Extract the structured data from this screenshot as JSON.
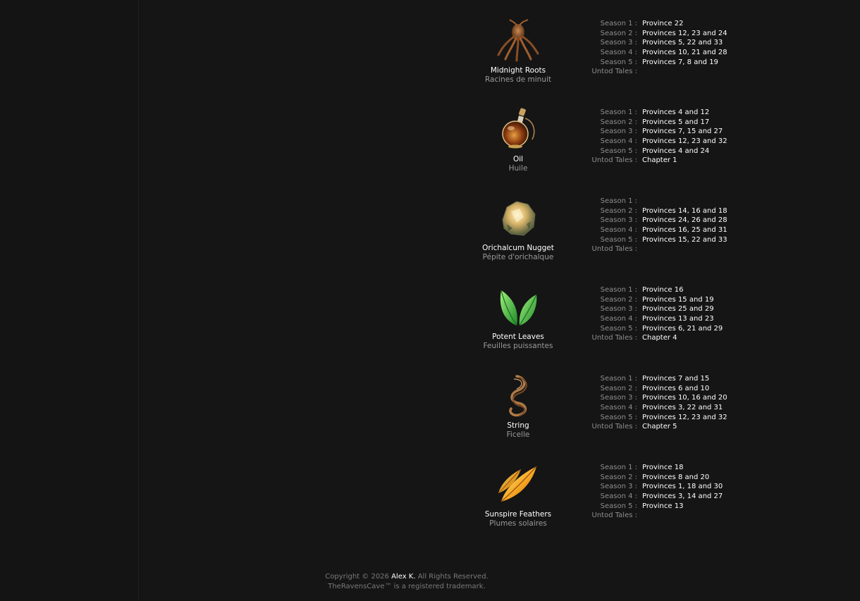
{
  "items": [
    {
      "name_en": "Midnight Roots",
      "name_fr": "Racines de minuit",
      "icon": "midnight-roots-icon",
      "locations": [
        {
          "label": "Season 1 :",
          "value": "Province 22"
        },
        {
          "label": "Season 2 :",
          "value": "Provinces 12, 23 and 24"
        },
        {
          "label": "Season 3 :",
          "value": "Provinces 5, 22 and 33"
        },
        {
          "label": "Season 4 :",
          "value": "Provinces 10, 21 and 28"
        },
        {
          "label": "Season 5 :",
          "value": "Provinces 7, 8 and 19"
        },
        {
          "label": "Untod Tales :",
          "value": ""
        }
      ]
    },
    {
      "name_en": "Oil",
      "name_fr": "Huile",
      "icon": "oil-flask-icon",
      "locations": [
        {
          "label": "Season 1 :",
          "value": "Provinces 4 and 12"
        },
        {
          "label": "Season 2 :",
          "value": "Provinces 5 and 17"
        },
        {
          "label": "Season 3 :",
          "value": "Provinces 7, 15 and 27"
        },
        {
          "label": "Season 4 :",
          "value": "Provinces 12, 23 and 32"
        },
        {
          "label": "Season 5 :",
          "value": "Provinces 4 and 24"
        },
        {
          "label": "Untod Tales :",
          "value": "Chapter 1"
        }
      ]
    },
    {
      "name_en": "Orichalcum Nugget",
      "name_fr": "Pépite d'orichalque",
      "icon": "orichalcum-nugget-icon",
      "locations": [
        {
          "label": "Season 1 :",
          "value": ""
        },
        {
          "label": "Season 2 :",
          "value": "Provinces 14, 16 and 18"
        },
        {
          "label": "Season 3 :",
          "value": "Provinces 24, 26 and 28"
        },
        {
          "label": "Season 4 :",
          "value": "Provinces 16, 25 and 31"
        },
        {
          "label": "Season 5 :",
          "value": "Provinces 15, 22 and 33"
        },
        {
          "label": "Untod Tales :",
          "value": ""
        }
      ]
    },
    {
      "name_en": "Potent Leaves",
      "name_fr": "Feuilles puissantes",
      "icon": "potent-leaves-icon",
      "locations": [
        {
          "label": "Season 1 :",
          "value": "Province 16"
        },
        {
          "label": "Season 2 :",
          "value": "Provinces 15 and 19"
        },
        {
          "label": "Season 3 :",
          "value": "Provinces 25 and 29"
        },
        {
          "label": "Season 4 :",
          "value": "Provinces 13 and 23"
        },
        {
          "label": "Season 5 :",
          "value": "Provinces 6, 21 and 29"
        },
        {
          "label": "Untod Tales :",
          "value": "Chapter 4"
        }
      ]
    },
    {
      "name_en": "String",
      "name_fr": "Ficelle",
      "icon": "string-coil-icon",
      "locations": [
        {
          "label": "Season 1 :",
          "value": "Provinces 7 and 15"
        },
        {
          "label": "Season 2 :",
          "value": "Provinces 6 and 10"
        },
        {
          "label": "Season 3 :",
          "value": "Provinces 10, 16 and 20"
        },
        {
          "label": "Season 4 :",
          "value": "Provinces 3, 22 and 31"
        },
        {
          "label": "Season 5 :",
          "value": "Provinces 12, 23 and 32"
        },
        {
          "label": "Untod Tales :",
          "value": "Chapter 5"
        }
      ]
    },
    {
      "name_en": "Sunspire Feathers",
      "name_fr": "Plumes solaires",
      "icon": "sunspire-feathers-icon",
      "locations": [
        {
          "label": "Season 1 :",
          "value": "Province 18"
        },
        {
          "label": "Season 2 :",
          "value": "Provinces 8 and 20"
        },
        {
          "label": "Season 3 :",
          "value": "Provinces 1, 18 and 30"
        },
        {
          "label": "Season 4 :",
          "value": "Provinces 3, 14 and 27"
        },
        {
          "label": "Season 5 :",
          "value": "Province 13"
        },
        {
          "label": "Untod Tales :",
          "value": ""
        }
      ]
    }
  ],
  "footer": {
    "copyright_prefix": "Copyright © 2026",
    "author": "Alex K.",
    "rights": "All Rights Reserved.",
    "trademark": "TheRavensCave™ is a registered trademark."
  }
}
